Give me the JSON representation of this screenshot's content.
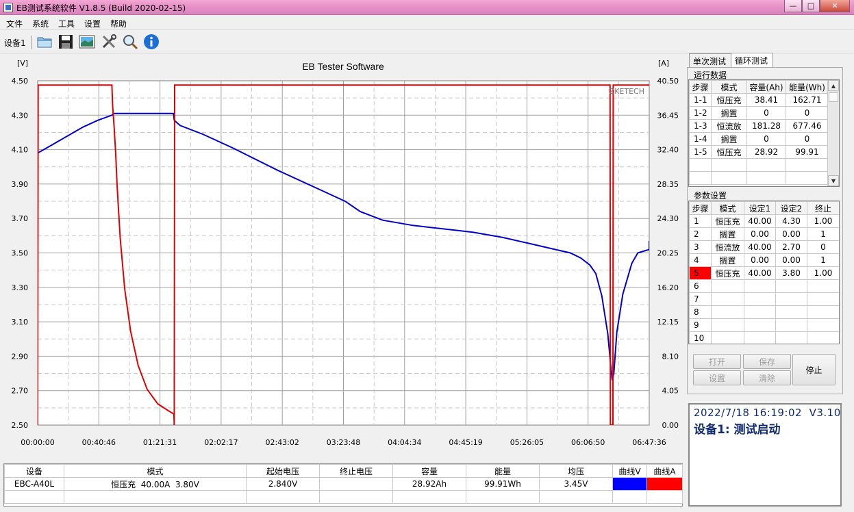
{
  "window": {
    "title": "EB测试系统软件 V1.8.5 (Build 2020-02-15)"
  },
  "menu": [
    "文件",
    "系统",
    "工具",
    "设置",
    "帮助"
  ],
  "toolbar": {
    "device_tab": "设备1"
  },
  "chart": {
    "title": "EB Tester Software",
    "left_unit": "[V]",
    "right_unit": "[A]",
    "watermark": "ZKETECH",
    "left_ticks": [
      "4.50",
      "4.30",
      "4.10",
      "3.90",
      "3.70",
      "3.50",
      "3.30",
      "3.10",
      "2.90",
      "2.70",
      "2.50"
    ],
    "right_ticks": [
      "40.50",
      "36.45",
      "32.40",
      "28.35",
      "24.30",
      "20.25",
      "16.20",
      "12.15",
      "8.10",
      "4.05",
      "0.00"
    ],
    "x_ticks": [
      "00:00:00",
      "00:40:46",
      "01:21:31",
      "02:02:17",
      "02:43:02",
      "03:23:48",
      "04:04:34",
      "04:45:19",
      "05:26:05",
      "06:06:50",
      "06:47:36"
    ],
    "voltage_color": "#0000c8",
    "current_color": "#e00000"
  },
  "chart_data": {
    "type": "line",
    "title": "EB Tester Software",
    "xlabel": "",
    "ylabel": "[V]",
    "y2label": "[A]",
    "x_unit": "minutes",
    "xlim": [
      0,
      407.6
    ],
    "ylim": [
      2.5,
      4.5
    ],
    "y2lim": [
      0,
      40.5
    ],
    "grid": true,
    "series": [
      {
        "axis": "left",
        "color": "#0000c8",
        "points": [
          [
            0,
            4.08
          ],
          [
            10,
            4.13
          ],
          [
            20,
            4.18
          ],
          [
            30,
            4.23
          ],
          [
            40,
            4.27
          ],
          [
            49.5,
            4.3
          ],
          [
            50.5,
            4.31
          ],
          [
            90.5,
            4.31
          ],
          [
            91,
            4.27
          ],
          [
            95,
            4.24
          ],
          [
            110,
            4.19
          ],
          [
            130,
            4.11
          ],
          [
            160,
            3.98
          ],
          [
            190,
            3.86
          ],
          [
            205,
            3.8
          ],
          [
            215,
            3.74
          ],
          [
            230,
            3.69
          ],
          [
            250,
            3.66
          ],
          [
            270,
            3.64
          ],
          [
            290,
            3.62
          ],
          [
            310,
            3.59
          ],
          [
            330,
            3.55
          ],
          [
            345,
            3.52
          ],
          [
            355,
            3.5
          ],
          [
            362,
            3.47
          ],
          [
            368,
            3.43
          ],
          [
            372,
            3.38
          ],
          [
            376,
            3.25
          ],
          [
            380,
            3.03
          ],
          [
            382,
            2.84
          ],
          [
            383,
            2.76
          ],
          [
            384,
            2.8
          ],
          [
            386,
            3.04
          ],
          [
            390,
            3.26
          ],
          [
            396,
            3.44
          ],
          [
            400,
            3.5
          ],
          [
            408,
            3.52
          ],
          [
            430,
            3.55
          ],
          [
            441,
            3.57
          ]
        ]
      },
      {
        "axis": "right",
        "color": "#e00000",
        "points": [
          [
            0,
            0
          ],
          [
            0.3,
            40
          ],
          [
            49.5,
            40
          ],
          [
            50,
            37.5
          ],
          [
            51,
            35
          ],
          [
            52,
            32
          ],
          [
            53,
            28
          ],
          [
            55,
            22
          ],
          [
            58,
            16
          ],
          [
            62,
            11
          ],
          [
            67,
            7
          ],
          [
            73,
            4.2
          ],
          [
            80,
            2.5
          ],
          [
            87,
            1.7
          ],
          [
            90.8,
            1.3
          ],
          [
            91,
            0
          ],
          [
            91.3,
            40
          ],
          [
            381.5,
            40
          ],
          [
            381.7,
            0
          ],
          [
            383.4,
            0
          ],
          [
            383.6,
            40
          ],
          [
            441,
            40
          ]
        ]
      }
    ]
  },
  "bottom_table": {
    "headers": [
      "设备",
      "模式",
      "起始电压",
      "终止电压",
      "容量",
      "能量",
      "均压",
      "曲线V",
      "曲线A"
    ],
    "row": [
      "EBC-A40L",
      "恒压充  40.00A  3.80V",
      "2.840V",
      "",
      "28.92Ah",
      "99.91Wh",
      "3.45V"
    ],
    "curve_v_color": "#0000ff",
    "curve_a_color": "#ff0000"
  },
  "tabs": [
    {
      "label": "单次测试",
      "active": false
    },
    {
      "label": "循环测试",
      "active": true
    }
  ],
  "run_data": {
    "title": "运行数据",
    "headers": [
      "步骤",
      "模式",
      "容量(Ah)",
      "能量(Wh)"
    ],
    "rows": [
      [
        "1-1",
        "恒压充",
        "38.41",
        "162.71"
      ],
      [
        "1-2",
        "搁置",
        "0",
        "0"
      ],
      [
        "1-3",
        "恒流放",
        "181.28",
        "677.46"
      ],
      [
        "1-4",
        "搁置",
        "0",
        "0"
      ],
      [
        "1-5",
        "恒压充",
        "28.92",
        "99.91"
      ]
    ]
  },
  "params": {
    "title": "参数设置",
    "headers": [
      "步骤",
      "模式",
      "设定1",
      "设定2",
      "终止"
    ],
    "rows": [
      [
        "1",
        "恒压充",
        "40.00",
        "4.30",
        "1.00"
      ],
      [
        "2",
        "搁置",
        "0.00",
        "0.00",
        "1"
      ],
      [
        "3",
        "恒流放",
        "40.00",
        "2.70",
        "0"
      ],
      [
        "4",
        "搁置",
        "0.00",
        "0.00",
        "1"
      ],
      [
        "5",
        "恒压充",
        "40.00",
        "3.80",
        "1.00"
      ],
      [
        "6",
        "",
        "",
        "",
        ""
      ],
      [
        "7",
        "",
        "",
        "",
        ""
      ],
      [
        "8",
        "",
        "",
        "",
        ""
      ],
      [
        "9",
        "",
        "",
        "",
        ""
      ],
      [
        "10",
        "",
        "",
        "",
        ""
      ]
    ],
    "highlight_step": "5",
    "highlight_color": "#ff0000"
  },
  "buttons": {
    "open": "打开",
    "save": "保存",
    "settings": "设置",
    "clear": "清除",
    "stop": "停止"
  },
  "status": {
    "line1": "2022/7/18 16:19:02  V3.10",
    "line2": "设备1: 测试启动"
  }
}
